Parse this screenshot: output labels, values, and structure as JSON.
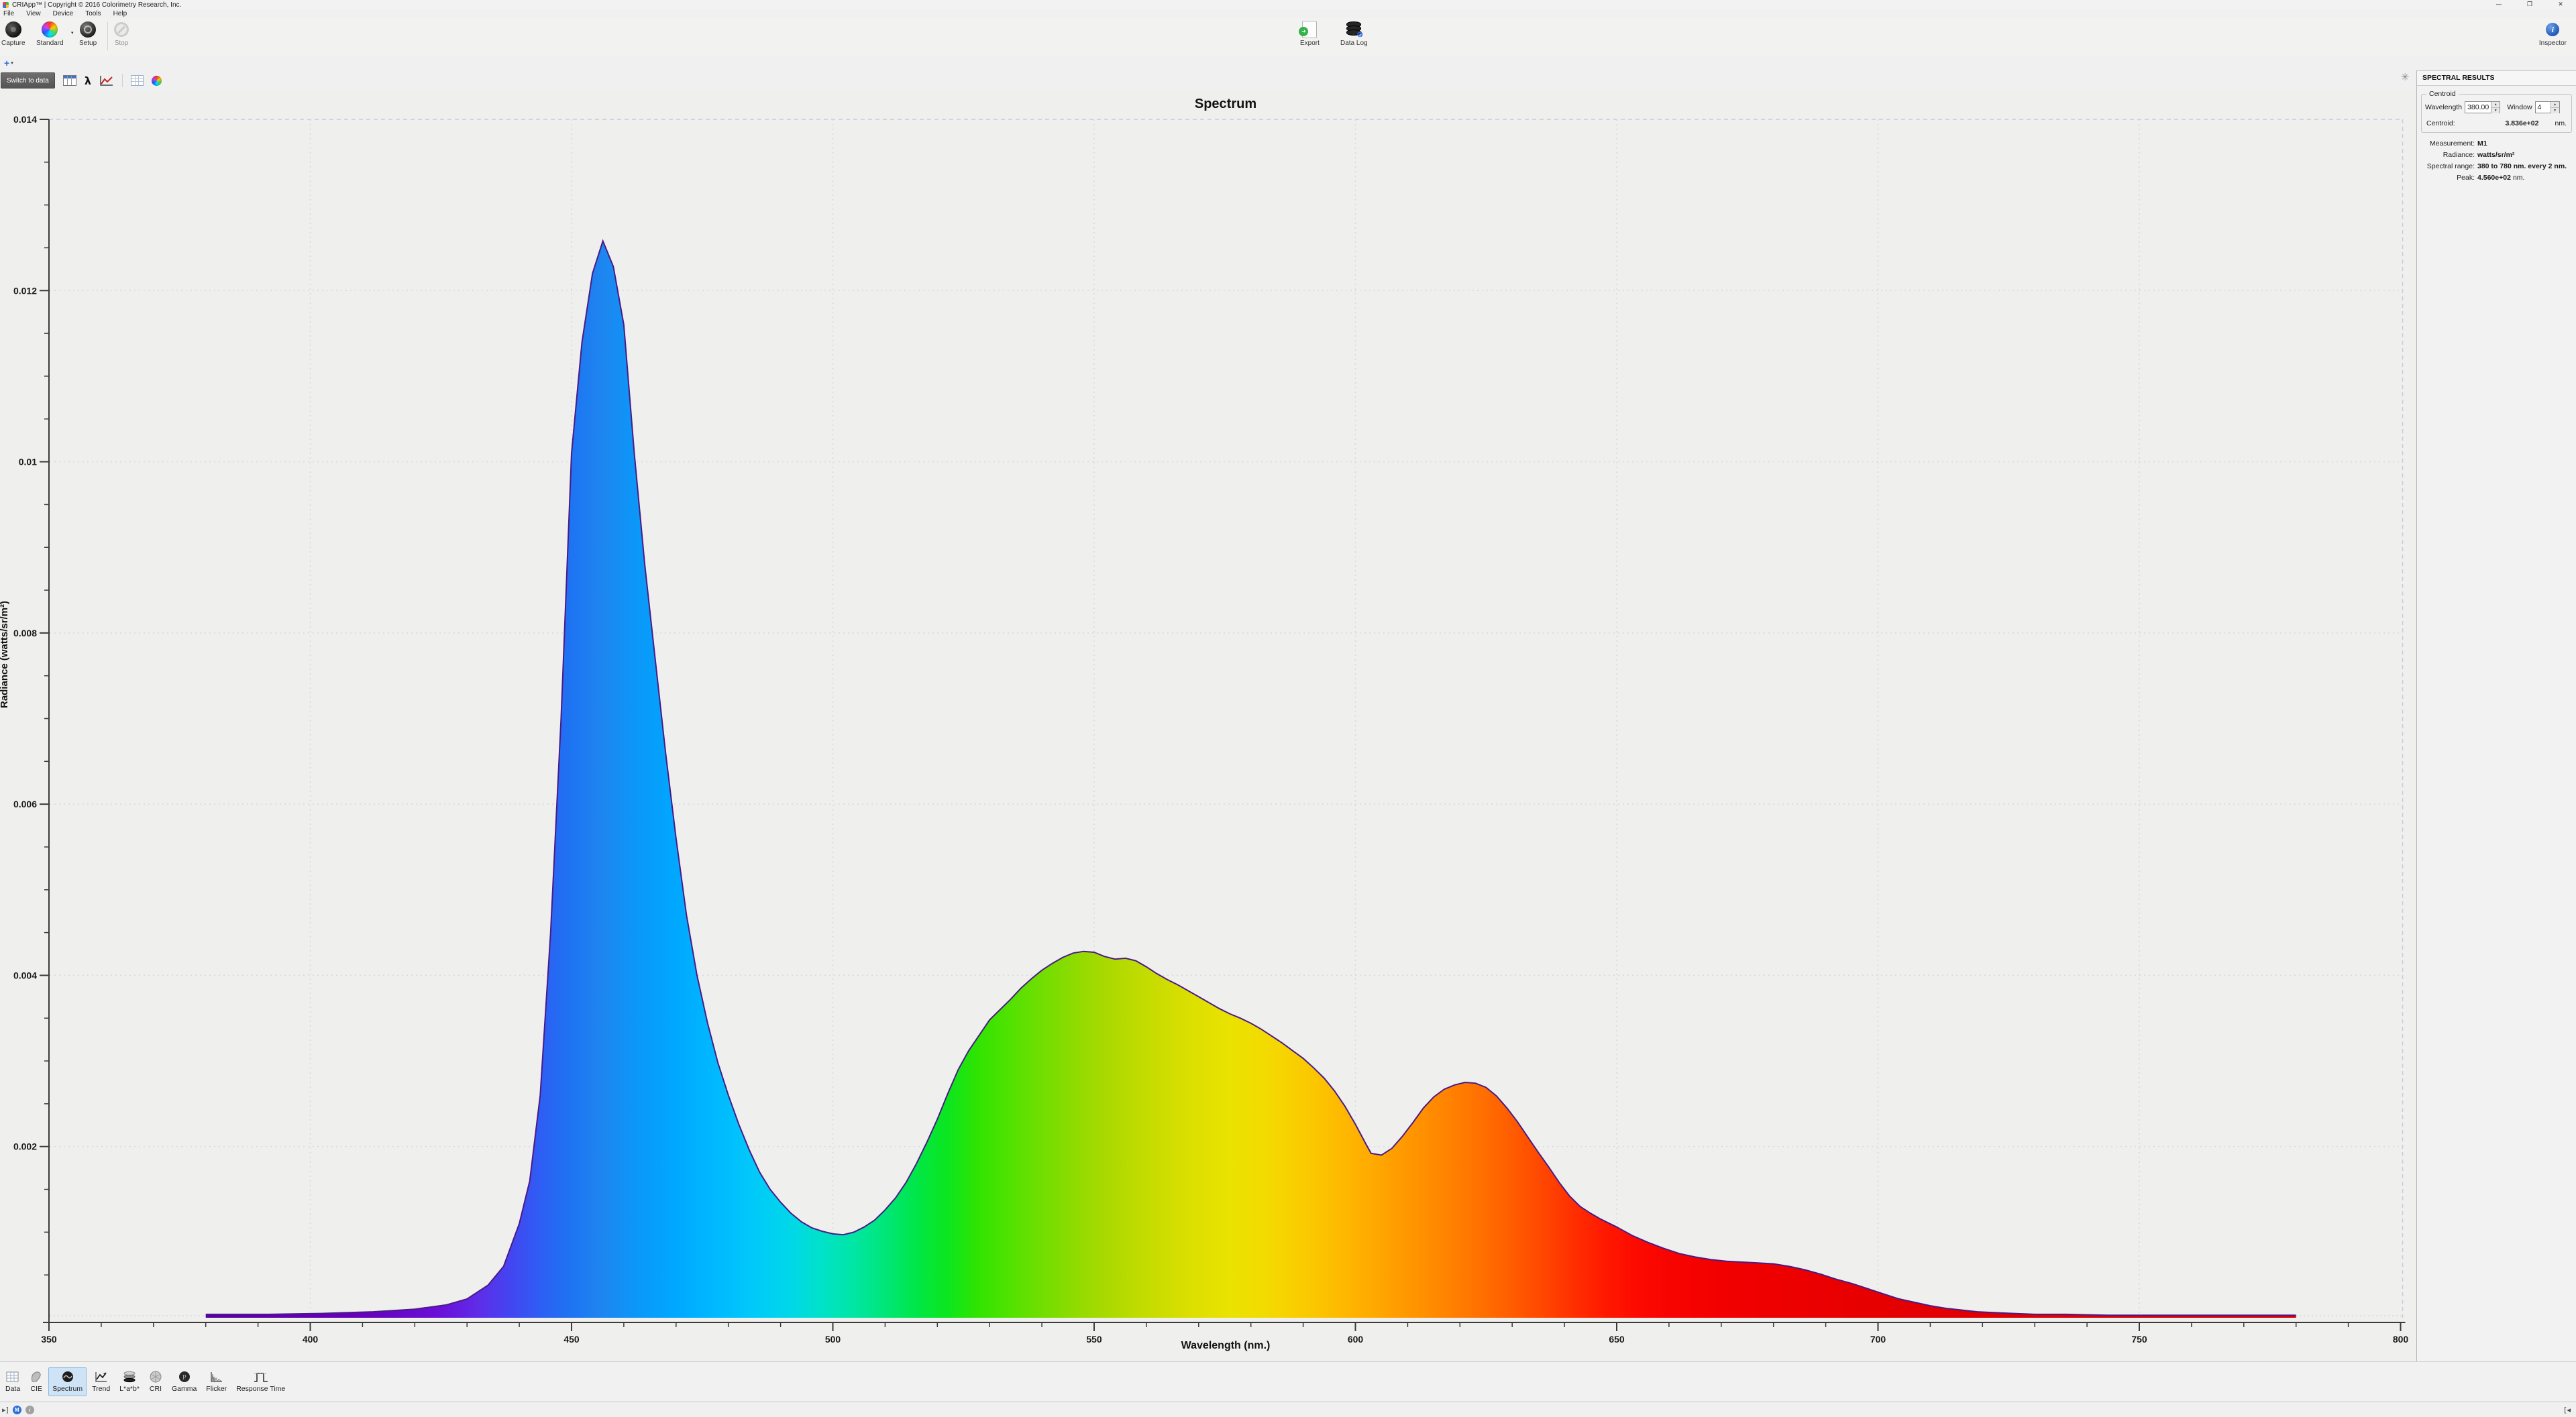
{
  "titlebar": {
    "title": "CRIApp™ | Copyright © 2016 Colorimetry Research, Inc.",
    "minimize": "—",
    "maximize": "❐",
    "close": "✕"
  },
  "menubar": {
    "items": [
      "File",
      "View",
      "Device",
      "Tools",
      "Help"
    ]
  },
  "toolbar": {
    "capture": "Capture",
    "standard": "Standard",
    "setup": "Setup",
    "stop": "Stop",
    "export": "Export",
    "data_log": "Data Log",
    "inspector": "Inspector"
  },
  "tab_strip": {
    "add_label": "+",
    "add_caret": "▾"
  },
  "chart_toolbar": {
    "switch_button": "Switch to data",
    "lambda": "λ"
  },
  "panel_toggle_glyph": "✳",
  "spectral_results": {
    "header": "SPECTRAL RESULTS",
    "centroid_group": {
      "legend": "Centroid",
      "wavelength_label": "Wavelength",
      "wavelength_value": "380.00",
      "window_label": "Window",
      "window_value": "4",
      "centroid_label": "Centroid:",
      "centroid_value": "3.836e+02",
      "centroid_unit": "nm."
    },
    "rows": [
      {
        "label": "Measurement:",
        "value": "M1",
        "unit": ""
      },
      {
        "label": "Radiance:",
        "value": "watts/sr/m²",
        "unit": ""
      },
      {
        "label": "Spectral range:",
        "value": "380 to 780 nm. every 2 nm.",
        "unit": ""
      },
      {
        "label": "Peak:",
        "value": "4.560e+02",
        "unit": "nm."
      }
    ]
  },
  "bottom_tabs": {
    "items": [
      "Data",
      "CIE",
      "Spectrum",
      "Trend",
      "L*a*b*",
      "CRI",
      "Gamma",
      "Flicker",
      "Response Time"
    ],
    "selected": "Spectrum"
  },
  "statusbar": {
    "left_icons": [
      "collapse-left-icon",
      "measurement-badge",
      "info-badge"
    ],
    "m_badge": "M",
    "i_badge": "i"
  },
  "chart_data": {
    "type": "area",
    "title": "Spectrum",
    "xlabel": "Wavelength (nm.)",
    "ylabel": "Radiance (watts/sr/m²)",
    "xlim": [
      350,
      800
    ],
    "ylim": [
      0,
      0.014
    ],
    "x_major_ticks": [
      350,
      400,
      450,
      500,
      550,
      600,
      650,
      700,
      750,
      800
    ],
    "x_minor_step": 10,
    "y_major_ticks": [
      0.002,
      0.004,
      0.006,
      0.008,
      0.01,
      0.012,
      0.014
    ],
    "y_minor_step": 0.0005,
    "grid": true,
    "legend_position": "none",
    "outline_color": "#4b1a86",
    "grid_color": "#d7d7ea",
    "border_dash_color": "#c9c9e4",
    "axis_color": "#3a3a3a",
    "peak_nm": 456.0,
    "centroid_nm": 383.6,
    "series": [
      {
        "name": "M1",
        "points": [
          [
            380,
            4e-05
          ],
          [
            392,
            4e-05
          ],
          [
            402,
            5e-05
          ],
          [
            412,
            7e-05
          ],
          [
            420,
            0.0001
          ],
          [
            426,
            0.00015
          ],
          [
            430,
            0.00022
          ],
          [
            434,
            0.00038
          ],
          [
            437,
            0.0006
          ],
          [
            440,
            0.0011
          ],
          [
            442,
            0.0016
          ],
          [
            444,
            0.0026
          ],
          [
            446,
            0.0045
          ],
          [
            448,
            0.007
          ],
          [
            450,
            0.0101
          ],
          [
            452,
            0.0114
          ],
          [
            454,
            0.0122
          ],
          [
            456,
            0.01258
          ],
          [
            458,
            0.01228
          ],
          [
            460,
            0.0116
          ],
          [
            462,
            0.0101
          ],
          [
            464,
            0.0088
          ],
          [
            466,
            0.0077
          ],
          [
            468,
            0.0066
          ],
          [
            470,
            0.0056
          ],
          [
            472,
            0.0047
          ],
          [
            474,
            0.004
          ],
          [
            476,
            0.00345
          ],
          [
            478,
            0.00298
          ],
          [
            480,
            0.0026
          ],
          [
            482,
            0.00226
          ],
          [
            484,
            0.00196
          ],
          [
            486,
            0.0017
          ],
          [
            488,
            0.0015
          ],
          [
            490,
            0.00135
          ],
          [
            492,
            0.00122
          ],
          [
            494,
            0.00112
          ],
          [
            496,
            0.00105
          ],
          [
            498,
            0.00101
          ],
          [
            500,
            0.00098
          ],
          [
            502,
            0.00097
          ],
          [
            504,
            0.001
          ],
          [
            506,
            0.00106
          ],
          [
            508,
            0.00114
          ],
          [
            510,
            0.00126
          ],
          [
            512,
            0.0014
          ],
          [
            514,
            0.00158
          ],
          [
            516,
            0.0018
          ],
          [
            518,
            0.00205
          ],
          [
            520,
            0.00232
          ],
          [
            522,
            0.00262
          ],
          [
            524,
            0.0029
          ],
          [
            526,
            0.00312
          ],
          [
            528,
            0.0033
          ],
          [
            530,
            0.00348
          ],
          [
            532,
            0.0036
          ],
          [
            534,
            0.00372
          ],
          [
            536,
            0.00385
          ],
          [
            538,
            0.00396
          ],
          [
            540,
            0.00406
          ],
          [
            542,
            0.00414
          ],
          [
            544,
            0.00421
          ],
          [
            546,
            0.00426
          ],
          [
            548,
            0.00428
          ],
          [
            550,
            0.00427
          ],
          [
            552,
            0.00422
          ],
          [
            554,
            0.00419
          ],
          [
            556,
            0.0042
          ],
          [
            558,
            0.00417
          ],
          [
            560,
            0.0041
          ],
          [
            562,
            0.00402
          ],
          [
            564,
            0.00395
          ],
          [
            566,
            0.00389
          ],
          [
            568,
            0.00382
          ],
          [
            570,
            0.00375
          ],
          [
            572,
            0.00368
          ],
          [
            574,
            0.00361
          ],
          [
            576,
            0.00355
          ],
          [
            578,
            0.0035
          ],
          [
            580,
            0.00344
          ],
          [
            582,
            0.00337
          ],
          [
            584,
            0.00329
          ],
          [
            586,
            0.00321
          ],
          [
            588,
            0.00312
          ],
          [
            590,
            0.00303
          ],
          [
            592,
            0.00292
          ],
          [
            594,
            0.0028
          ],
          [
            596,
            0.00265
          ],
          [
            598,
            0.00247
          ],
          [
            600,
            0.00226
          ],
          [
            602,
            0.00203
          ],
          [
            603,
            0.00192
          ],
          [
            605,
            0.0019
          ],
          [
            607,
            0.00198
          ],
          [
            609,
            0.00212
          ],
          [
            611,
            0.00228
          ],
          [
            613,
            0.00245
          ],
          [
            615,
            0.00258
          ],
          [
            617,
            0.00267
          ],
          [
            619,
            0.00272
          ],
          [
            621,
            0.00275
          ],
          [
            623,
            0.00274
          ],
          [
            625,
            0.00269
          ],
          [
            627,
            0.00259
          ],
          [
            629,
            0.00245
          ],
          [
            631,
            0.00229
          ],
          [
            633,
            0.00211
          ],
          [
            635,
            0.00193
          ],
          [
            637,
            0.00176
          ],
          [
            639,
            0.00158
          ],
          [
            641,
            0.00142
          ],
          [
            643,
            0.0013
          ],
          [
            645,
            0.00122
          ],
          [
            647,
            0.00115
          ],
          [
            650,
            0.00106
          ],
          [
            653,
            0.00096
          ],
          [
            656,
            0.00088
          ],
          [
            659,
            0.00081
          ],
          [
            662,
            0.00075
          ],
          [
            665,
            0.00071
          ],
          [
            668,
            0.00068
          ],
          [
            671,
            0.00066
          ],
          [
            674,
            0.00065
          ],
          [
            677,
            0.00064
          ],
          [
            680,
            0.00063
          ],
          [
            683,
            0.0006
          ],
          [
            686,
            0.00056
          ],
          [
            689,
            0.00051
          ],
          [
            692,
            0.00045
          ],
          [
            695,
            0.0004
          ],
          [
            698,
            0.00034
          ],
          [
            701,
            0.00028
          ],
          [
            704,
            0.00022
          ],
          [
            707,
            0.00018
          ],
          [
            710,
            0.00014
          ],
          [
            713,
            0.00011
          ],
          [
            716,
            9e-05
          ],
          [
            719,
            7e-05
          ],
          [
            722,
            6e-05
          ],
          [
            726,
            5e-05
          ],
          [
            730,
            4e-05
          ],
          [
            736,
            4e-05
          ],
          [
            744,
            3e-05
          ],
          [
            756,
            3e-05
          ],
          [
            768,
            3e-05
          ],
          [
            780,
            3e-05
          ]
        ]
      }
    ],
    "gradient_stops": [
      [
        380,
        "#5a00a0"
      ],
      [
        410,
        "#6600bc"
      ],
      [
        425,
        "#6a10d8"
      ],
      [
        432,
        "#5f2ce8"
      ],
      [
        438,
        "#4444f0"
      ],
      [
        444,
        "#2e5ef4"
      ],
      [
        450,
        "#1e74f2"
      ],
      [
        456,
        "#1e86f0"
      ],
      [
        462,
        "#0c96f8"
      ],
      [
        470,
        "#00a8ff"
      ],
      [
        478,
        "#00baff"
      ],
      [
        486,
        "#00ccf8"
      ],
      [
        492,
        "#00d8e8"
      ],
      [
        498,
        "#00e2c8"
      ],
      [
        504,
        "#00e6a4"
      ],
      [
        510,
        "#00e678"
      ],
      [
        516,
        "#00e648"
      ],
      [
        522,
        "#0ce61e"
      ],
      [
        528,
        "#32e400"
      ],
      [
        534,
        "#52e200"
      ],
      [
        540,
        "#71de00"
      ],
      [
        546,
        "#8edb00"
      ],
      [
        552,
        "#a8da00"
      ],
      [
        558,
        "#bedb00"
      ],
      [
        564,
        "#d0dd00"
      ],
      [
        570,
        "#dfe000"
      ],
      [
        576,
        "#eae200"
      ],
      [
        582,
        "#f2dc00"
      ],
      [
        588,
        "#f8d000"
      ],
      [
        594,
        "#fcc200"
      ],
      [
        600,
        "#ffb200"
      ],
      [
        606,
        "#ffa200"
      ],
      [
        612,
        "#ff9200"
      ],
      [
        618,
        "#ff8200"
      ],
      [
        624,
        "#ff7000"
      ],
      [
        630,
        "#ff5c00"
      ],
      [
        636,
        "#ff4600"
      ],
      [
        642,
        "#ff2e00"
      ],
      [
        648,
        "#ff1800"
      ],
      [
        654,
        "#fc0a00"
      ],
      [
        660,
        "#f80400"
      ],
      [
        670,
        "#f20000"
      ],
      [
        685,
        "#ec0000"
      ],
      [
        700,
        "#e60000"
      ],
      [
        720,
        "#e00000"
      ],
      [
        780,
        "#da0000"
      ]
    ]
  }
}
